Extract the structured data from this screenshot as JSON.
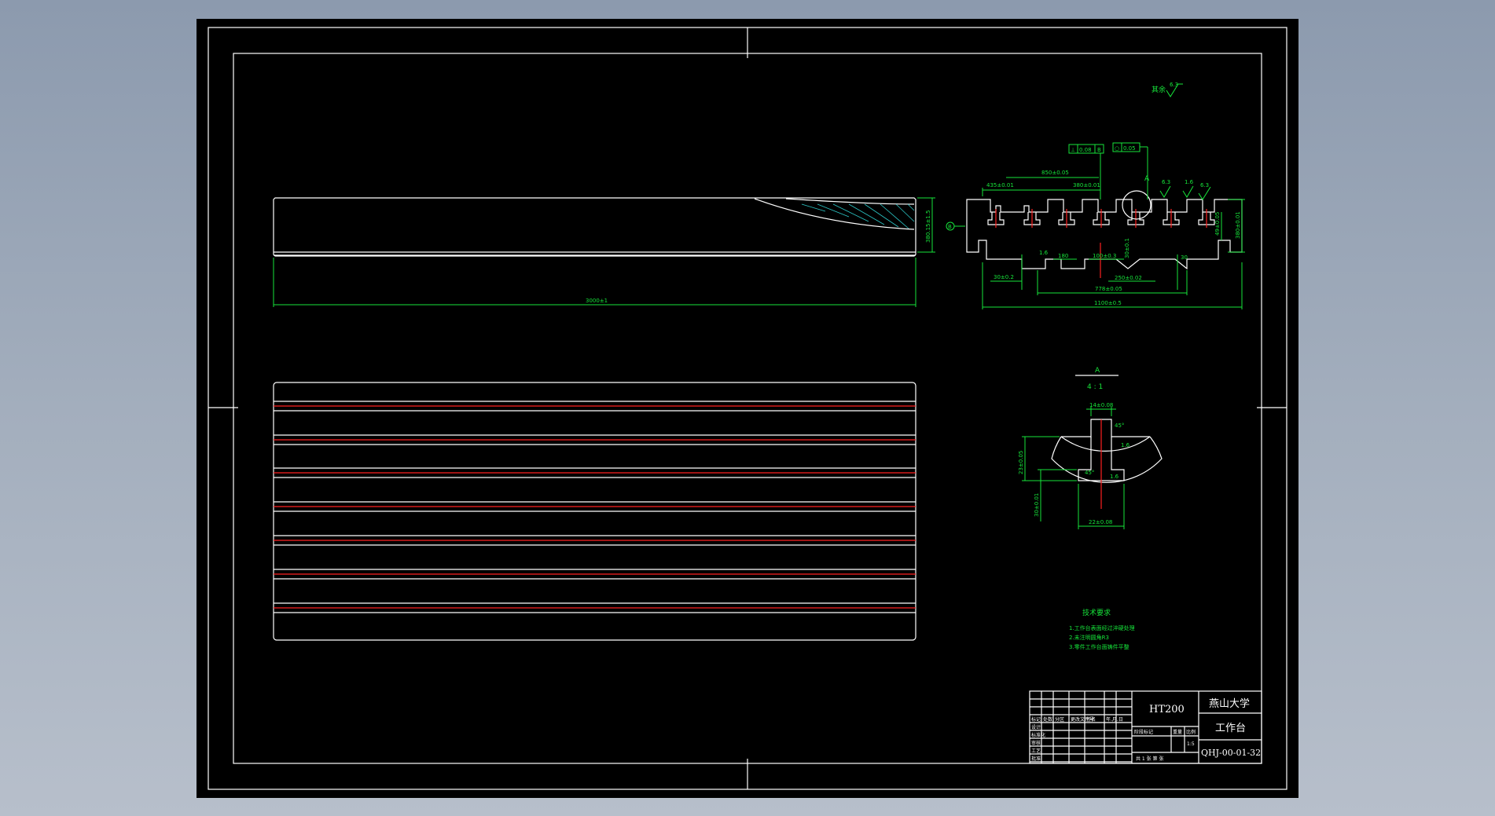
{
  "drawing": {
    "top_view_length_dim": "3000±1",
    "top_view_height_dim": "380.15±1.5",
    "section": {
      "roughness_label": "其余",
      "roughness_value": "6.3",
      "flatness_symbol": "⊥",
      "flatness_value": "0.08",
      "flatness_ref": "B",
      "circ_symbol": "○",
      "circ_value": "0.05",
      "dim_top_overall": "850±0.05",
      "dim_top_left": "435±0.01",
      "dim_top_right": "380±0.01",
      "detail_marker": "A",
      "roughness_right_1": "6.3",
      "roughness_right_2": "1.6",
      "roughness_right_3": "6.3",
      "datum_left": "B",
      "dim_right_height": "380±0.01",
      "dim_right_inner": "49±0.05",
      "dim_bottom_1": "1.6",
      "dim_bottom_2": "180",
      "dim_bottom_3": "100±0.3",
      "dim_bottom_4": "30±0.1",
      "dim_bottom_5": "250±0.02",
      "dim_bottom_6": "30",
      "dim_bottom_left": "30±0.2",
      "dim_bottom_778": "778±0.05",
      "dim_bottom_overall": "1100±0.5"
    },
    "detail": {
      "title": "A",
      "scale": "4 : 1",
      "dim_top": "14±0.08",
      "dim_left": "23±0.05",
      "dim_left_lower": "30±0.01",
      "dim_bottom": "22±0.08",
      "angle_1": "45°",
      "angle_2": "45°",
      "mark_1": "1.6",
      "mark_2": "1.6"
    },
    "notes": {
      "title": "技术要求",
      "lines": [
        "1.工作台表面经过淬硬处理",
        "2.未注明圆角R3",
        "3.零件工作台面铸件平整"
      ]
    },
    "title_block": {
      "material": "HT200",
      "school": "燕山大学",
      "part_name": "工作台",
      "drawing_no": "QHJ-00-01-32",
      "scale": "1:5",
      "sheet": "共 1 张 第 张",
      "header_labels": [
        "标记",
        "处数",
        "分区",
        "更改文件号",
        "签名",
        "年.月.日"
      ],
      "row_labels": [
        "设计",
        "标准化",
        "审核",
        "工艺",
        "批准"
      ],
      "stage_labels": [
        "阶段标记",
        "重量",
        "比例"
      ]
    }
  },
  "colors": {
    "outline": "#ffffff",
    "dimension": "#16e53a",
    "centerline": "#ff2020",
    "background": "#000000"
  }
}
